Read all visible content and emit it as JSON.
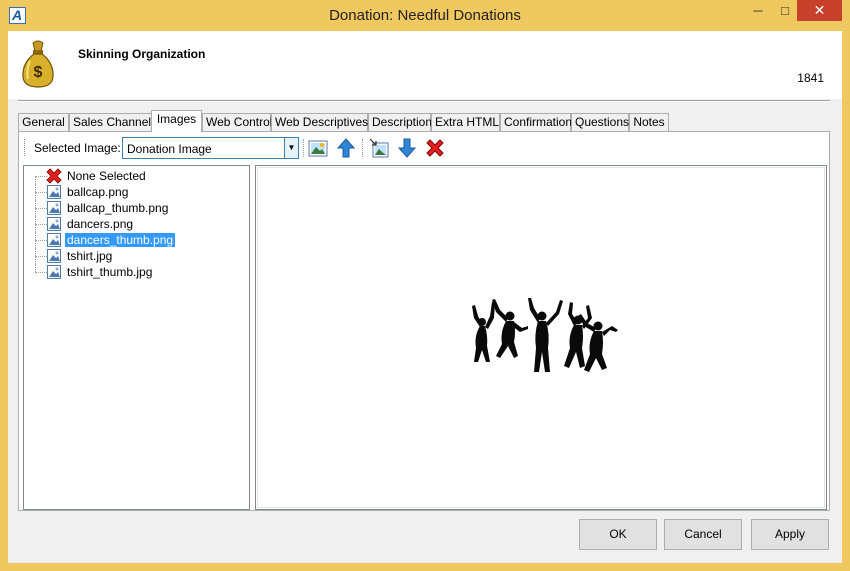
{
  "window": {
    "title": "Donation: Needful Donations",
    "app_icon_letter": "A",
    "minimize_glyph": "─",
    "maximize_glyph": "□",
    "close_glyph": "✕"
  },
  "header": {
    "organization": "Skinning Organization",
    "id": "1841",
    "icon": "money-bag-icon"
  },
  "tabs": [
    {
      "label": "General"
    },
    {
      "label": "Sales Channels"
    },
    {
      "label": "Images",
      "active": true
    },
    {
      "label": "Web Control"
    },
    {
      "label": "Web Descriptives"
    },
    {
      "label": "Description"
    },
    {
      "label": "Extra HTML"
    },
    {
      "label": "Confirmation"
    },
    {
      "label": "Questions"
    },
    {
      "label": "Notes"
    }
  ],
  "toolbar": {
    "selected_image_label": "Selected Image:",
    "selected_image_value": "Donation Image",
    "combo_arrow": "▼",
    "tools": [
      "add-image-icon",
      "upload-arrow-icon",
      "replace-image-icon",
      "download-arrow-icon",
      "delete-icon"
    ]
  },
  "image_list": [
    {
      "label": "None Selected",
      "icon": "red-x-icon"
    },
    {
      "label": "ballcap.png",
      "icon": "image-file-icon"
    },
    {
      "label": "ballcap_thumb.png",
      "icon": "image-file-icon"
    },
    {
      "label": "dancers.png",
      "icon": "image-file-icon"
    },
    {
      "label": "dancers_thumb.png",
      "icon": "image-file-icon",
      "selected": true
    },
    {
      "label": "tshirt.jpg",
      "icon": "image-file-icon"
    },
    {
      "label": "tshirt_thumb.jpg",
      "icon": "image-file-icon"
    }
  ],
  "preview": {
    "image": "dancers-silhouette"
  },
  "buttons": {
    "ok": "OK",
    "cancel": "Cancel",
    "apply": "Apply"
  },
  "colors": {
    "title_bar": "#f0c860",
    "selection": "#3399ff",
    "close": "#c7402c"
  }
}
